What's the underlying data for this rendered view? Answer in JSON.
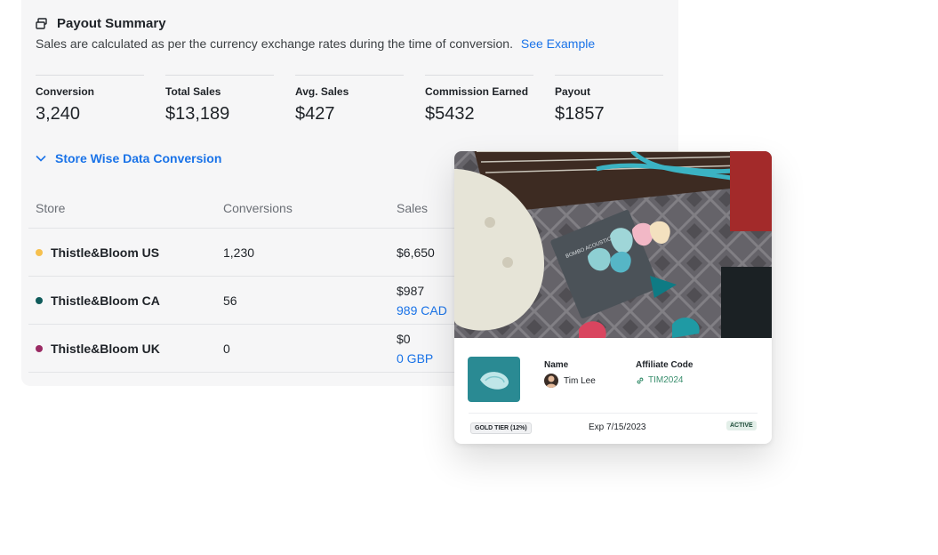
{
  "summary": {
    "title": "Payout Summary",
    "subtitle": "Sales are calculated as per the currency exchange rates during the time of conversion.",
    "link": "See Example",
    "metrics": [
      {
        "label": "Conversion",
        "value": "3,240"
      },
      {
        "label": "Total Sales",
        "value": "$13,189"
      },
      {
        "label": "Avg. Sales",
        "value": "$427"
      },
      {
        "label": "Commission Earned",
        "value": "$5432"
      },
      {
        "label": "Payout",
        "value": "$1857"
      }
    ],
    "toggle_label": "Store Wise Data Conversion"
  },
  "table": {
    "headers": [
      "Store",
      "Conversions",
      "Sales"
    ],
    "rows": [
      {
        "store": "Thistle&Bloom US",
        "dot_color": "#f6c04e",
        "conversions": "1,230",
        "sales": "$6,650",
        "sales_local": ""
      },
      {
        "store": "Thistle&Bloom CA",
        "dot_color": "#0f5b5b",
        "conversions": "56",
        "sales": "$987",
        "sales_local": "989 CAD"
      },
      {
        "store": "Thistle&Bloom UK",
        "dot_color": "#9a2a63",
        "conversions": "0",
        "sales": "$0",
        "sales_local": "0 GBP"
      }
    ]
  },
  "card": {
    "name_label": "Name",
    "name_value": "Tim Lee",
    "code_label": "Affiliate Code",
    "code_value": "TIM2024",
    "tier": "GOLD TIER (12%)",
    "expiry": "Exp 7/15/2023",
    "status": "ACTIVE"
  },
  "colors": {
    "accent": "#1a73e8",
    "panel_bg": "#f6f6f7",
    "code_green": "#3a8f6e"
  }
}
